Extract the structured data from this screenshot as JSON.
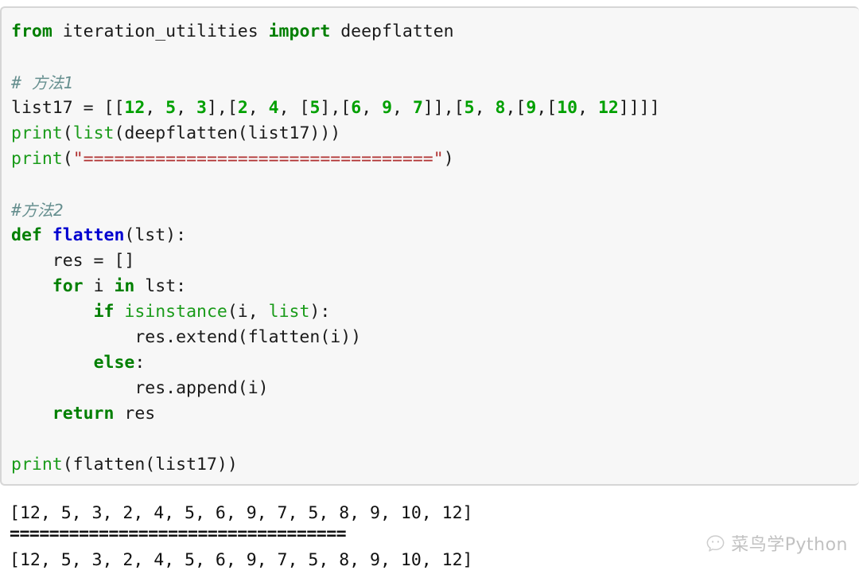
{
  "colors": {
    "code_background": "#f7f7f7",
    "output_background": "#ffffff",
    "keyword": "#007f00",
    "builtin": "#1a9b1a",
    "function_name": "#0000cf",
    "number": "#00a000",
    "string": "#b03030",
    "comment": "#668f8f",
    "text": "#1a1a1a",
    "border": "#d6d6d6"
  },
  "code_cell": {
    "language": "python",
    "lines": [
      {
        "id": "import-line",
        "tokens": [
          {
            "t": "from",
            "c": "kw"
          },
          {
            "t": " iteration_utilities ",
            "c": "plain"
          },
          {
            "t": "import",
            "c": "kw"
          },
          {
            "t": " deepflatten",
            "c": "plain"
          }
        ]
      },
      {
        "id": "blank-1",
        "tokens": []
      },
      {
        "id": "comment-method-1",
        "tokens": [
          {
            "t": "# ",
            "c": "com"
          },
          {
            "t": "方法1",
            "c": "com com-cjk"
          }
        ]
      },
      {
        "id": "list17-assignment",
        "tokens": [
          {
            "t": "list17 = [[",
            "c": "plain"
          },
          {
            "t": "12",
            "c": "num"
          },
          {
            "t": ", ",
            "c": "plain"
          },
          {
            "t": "5",
            "c": "num"
          },
          {
            "t": ", ",
            "c": "plain"
          },
          {
            "t": "3",
            "c": "num"
          },
          {
            "t": "],[",
            "c": "plain"
          },
          {
            "t": "2",
            "c": "num"
          },
          {
            "t": ", ",
            "c": "plain"
          },
          {
            "t": "4",
            "c": "num"
          },
          {
            "t": ", [",
            "c": "plain"
          },
          {
            "t": "5",
            "c": "num"
          },
          {
            "t": "],[",
            "c": "plain"
          },
          {
            "t": "6",
            "c": "num"
          },
          {
            "t": ", ",
            "c": "plain"
          },
          {
            "t": "9",
            "c": "num"
          },
          {
            "t": ", ",
            "c": "plain"
          },
          {
            "t": "7",
            "c": "num"
          },
          {
            "t": "]],[",
            "c": "plain"
          },
          {
            "t": "5",
            "c": "num"
          },
          {
            "t": ", ",
            "c": "plain"
          },
          {
            "t": "8",
            "c": "num"
          },
          {
            "t": ",[",
            "c": "plain"
          },
          {
            "t": "9",
            "c": "num"
          },
          {
            "t": ",[",
            "c": "plain"
          },
          {
            "t": "10",
            "c": "num"
          },
          {
            "t": ", ",
            "c": "plain"
          },
          {
            "t": "12",
            "c": "num"
          },
          {
            "t": "]]]]",
            "c": "plain"
          }
        ]
      },
      {
        "id": "print-deepflatten",
        "tokens": [
          {
            "t": "print",
            "c": "builtin"
          },
          {
            "t": "(",
            "c": "plain"
          },
          {
            "t": "list",
            "c": "builtin"
          },
          {
            "t": "(deepflatten(list17)))",
            "c": "plain"
          }
        ]
      },
      {
        "id": "print-separator",
        "tokens": [
          {
            "t": "print",
            "c": "builtin"
          },
          {
            "t": "(",
            "c": "plain"
          },
          {
            "t": "\"==================================\"",
            "c": "str"
          },
          {
            "t": ")",
            "c": "plain"
          }
        ]
      },
      {
        "id": "blank-2",
        "tokens": []
      },
      {
        "id": "comment-method-2",
        "tokens": [
          {
            "t": "#",
            "c": "com"
          },
          {
            "t": "方法2",
            "c": "com com-cjk"
          }
        ]
      },
      {
        "id": "def-flatten",
        "tokens": [
          {
            "t": "def",
            "c": "kw"
          },
          {
            "t": " ",
            "c": "plain"
          },
          {
            "t": "flatten",
            "c": "fname"
          },
          {
            "t": "(lst):",
            "c": "plain"
          }
        ]
      },
      {
        "id": "res-init",
        "tokens": [
          {
            "t": "    res = []",
            "c": "plain"
          }
        ]
      },
      {
        "id": "for-loop",
        "tokens": [
          {
            "t": "    ",
            "c": "plain"
          },
          {
            "t": "for",
            "c": "kw"
          },
          {
            "t": " i ",
            "c": "plain"
          },
          {
            "t": "in",
            "c": "kw"
          },
          {
            "t": " lst:",
            "c": "plain"
          }
        ]
      },
      {
        "id": "if-isinstance",
        "tokens": [
          {
            "t": "        ",
            "c": "plain"
          },
          {
            "t": "if",
            "c": "kw"
          },
          {
            "t": " ",
            "c": "plain"
          },
          {
            "t": "isinstance",
            "c": "builtin"
          },
          {
            "t": "(i, ",
            "c": "plain"
          },
          {
            "t": "list",
            "c": "builtin"
          },
          {
            "t": "):",
            "c": "plain"
          }
        ]
      },
      {
        "id": "res-extend",
        "tokens": [
          {
            "t": "            res.extend(flatten(i))",
            "c": "plain"
          }
        ]
      },
      {
        "id": "else-branch",
        "tokens": [
          {
            "t": "        ",
            "c": "plain"
          },
          {
            "t": "else",
            "c": "kw"
          },
          {
            "t": ":",
            "c": "plain"
          }
        ]
      },
      {
        "id": "res-append",
        "tokens": [
          {
            "t": "            res.append(i)",
            "c": "plain"
          }
        ]
      },
      {
        "id": "return-res",
        "tokens": [
          {
            "t": "    ",
            "c": "plain"
          },
          {
            "t": "return",
            "c": "kw"
          },
          {
            "t": " res",
            "c": "plain"
          }
        ]
      },
      {
        "id": "blank-3",
        "tokens": []
      },
      {
        "id": "print-flatten",
        "tokens": [
          {
            "t": "print",
            "c": "builtin"
          },
          {
            "t": "(flatten(list17))",
            "c": "plain"
          }
        ]
      }
    ]
  },
  "output_cell": {
    "lines": [
      {
        "id": "output-list-1",
        "text": "[12, 5, 3, 2, 4, 5, 6, 9, 7, 5, 8, 9, 10, 12]",
        "kind": "text"
      },
      {
        "id": "output-separator",
        "text": "==================================",
        "kind": "separator"
      },
      {
        "id": "output-list-2",
        "text": "[12, 5, 3, 2, 4, 5, 6, 9, 7, 5, 8, 9, 10, 12]",
        "kind": "text"
      }
    ]
  },
  "watermark": {
    "icon": "wechat-speech-bubble-icon",
    "text": "菜鸟学Python"
  }
}
